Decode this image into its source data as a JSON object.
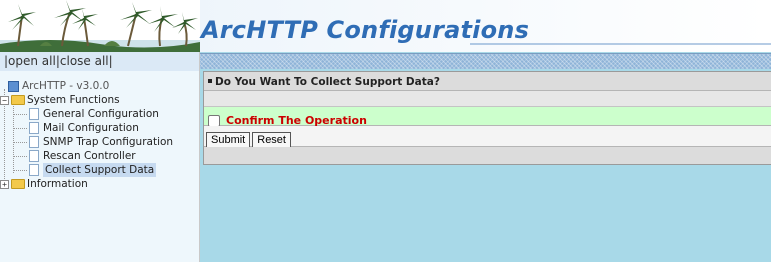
{
  "header": {
    "title": "ArcHTTP Configurations"
  },
  "sidebar": {
    "open_all": "open all",
    "close_all": "close all",
    "sep": "|",
    "root": "ArcHTTP - v3.0.0",
    "system_functions": "System Functions",
    "items": [
      {
        "label": "General Configuration"
      },
      {
        "label": "Mail Configuration"
      },
      {
        "label": "SNMP Trap Configuration"
      },
      {
        "label": "Rescan Controller"
      },
      {
        "label": "Collect Support Data"
      }
    ],
    "information": "Information"
  },
  "main": {
    "question": "Do You Want To Collect Support Data?",
    "confirm_label": "Confirm The Operation",
    "submit_label": "Submit",
    "reset_label": "Reset"
  },
  "colors": {
    "title": "#2f6db5",
    "confirm_row_bg": "#ccffcc",
    "confirm_text": "#cc0000",
    "right_bg": "#a8d9e8",
    "left_bg": "#eef7fc"
  }
}
